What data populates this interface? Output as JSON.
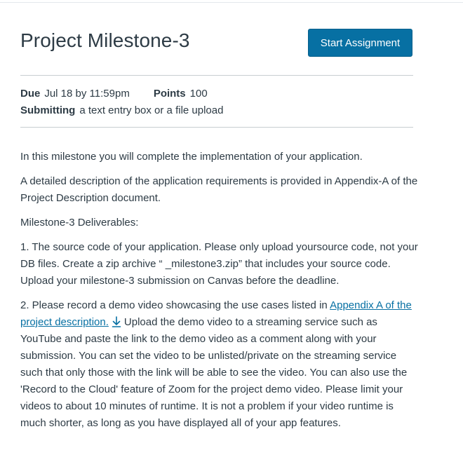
{
  "assignment": {
    "title": "Project Milestone-3",
    "start_button_label": "Start Assignment"
  },
  "details": {
    "due_label": "Due",
    "due_value": "Jul 18 by 11:59pm",
    "points_label": "Points",
    "points_value": "100",
    "submitting_label": "Submitting",
    "submitting_value": "a text entry box or a file upload"
  },
  "description": {
    "intro": "In this milestone you will complete the implementation of your application.",
    "requirements": "A detailed description of the application requirements is provided in Appendix-A of the Project Description document.",
    "deliverables_heading": "Milestone-3 Deliverables:",
    "deliverable_1": "1. The source code of your application. Please only upload yoursource code, not your DB files. Create a zip archive “ _milestone3.zip” that includes your source code. Upload your milestone-3 submission on Canvas before the deadline.",
    "deliverable_2_prefix": "2. Please record a demo video showcasing the use cases listed in ",
    "deliverable_2_link": "Appendix A of the project description.",
    "deliverable_2_suffix": "Upload the demo video to a streaming service such as YouTube and paste the link to the demo video as a comment along with your submission. You can set the video to be unlisted/private on the streaming service such that only those with the link will be able to see the video. You can also use the 'Record to the Cloud' feature of Zoom for the project demo video. Please limit your videos to about 10 minutes of runtime. It is not a problem if your video runtime is much shorter, as long as you have displayed all of your app features.",
    "download_icon": "download-icon"
  },
  "colors": {
    "accent": "#0770a3",
    "text": "#2d3b45",
    "divider": "#c7cdd1"
  }
}
